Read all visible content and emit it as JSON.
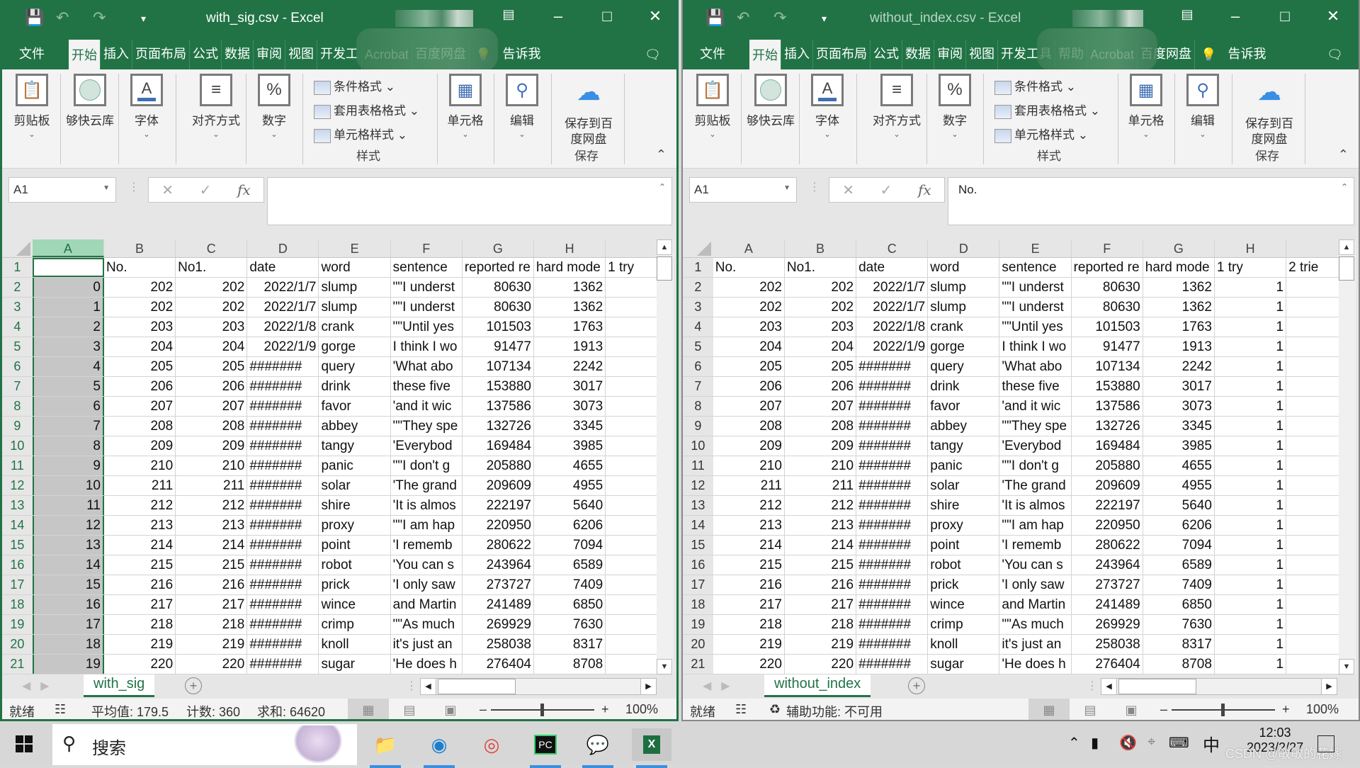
{
  "colors": {
    "excel_green": "#217346",
    "selected_header": "#a0d8b7",
    "selected_col": "#c6c6c6"
  },
  "windows": [
    {
      "title": "with_sig.csv  -  Excel",
      "ribbon_tabs": [
        "文件",
        "开始",
        "插入",
        "页面布局",
        "公式",
        "数据",
        "审阅",
        "视图",
        "开发工",
        "Acrobat",
        "百度网盘"
      ],
      "tell_me": "告诉我",
      "ribbon": {
        "clipboard": "剪贴板",
        "cloud": "够快云库",
        "font": "字体",
        "align": "对齐方式",
        "number": "数字",
        "cond_format": "条件格式",
        "table_format": "套用表格格式",
        "cell_style": "单元格样式",
        "styles_group": "样式",
        "cells": "单元格",
        "edit": "编辑",
        "save_baidu": "保存到百度网盘",
        "save_group": "保存"
      },
      "name_box": "A1",
      "formula": "",
      "columns": [
        "A",
        "B",
        "C",
        "D",
        "E",
        "F",
        "G",
        "H"
      ],
      "selected_column": "A",
      "rows": [
        [
          "",
          "No.",
          "No1.",
          "date",
          "word",
          "sentence",
          "reported re",
          "hard mode",
          "1 try"
        ],
        [
          "0",
          "202",
          "202",
          "2022/1/7",
          "slump",
          "\"\"I underst",
          "80630",
          "1362",
          ""
        ],
        [
          "1",
          "202",
          "202",
          "2022/1/7",
          "slump",
          "\"\"I underst",
          "80630",
          "1362",
          ""
        ],
        [
          "2",
          "203",
          "203",
          "2022/1/8",
          "crank",
          "\"\"Until yes",
          "101503",
          "1763",
          ""
        ],
        [
          "3",
          "204",
          "204",
          "2022/1/9",
          "gorge",
          "I think I wo",
          "91477",
          "1913",
          ""
        ],
        [
          "4",
          "205",
          "205",
          "#######",
          "query",
          "'What abo",
          "107134",
          "2242",
          ""
        ],
        [
          "5",
          "206",
          "206",
          "#######",
          "drink",
          "these five",
          "153880",
          "3017",
          ""
        ],
        [
          "6",
          "207",
          "207",
          "#######",
          "favor",
          "'and it wic",
          "137586",
          "3073",
          ""
        ],
        [
          "7",
          "208",
          "208",
          "#######",
          "abbey",
          "\"\"They spe",
          "132726",
          "3345",
          ""
        ],
        [
          "8",
          "209",
          "209",
          "#######",
          "tangy",
          "'Everybod",
          "169484",
          "3985",
          ""
        ],
        [
          "9",
          "210",
          "210",
          "#######",
          "panic",
          "\"\"I don't g",
          "205880",
          "4655",
          ""
        ],
        [
          "10",
          "211",
          "211",
          "#######",
          "solar",
          "'The grand",
          "209609",
          "4955",
          ""
        ],
        [
          "11",
          "212",
          "212",
          "#######",
          "shire",
          "'It is almos",
          "222197",
          "5640",
          ""
        ],
        [
          "12",
          "213",
          "213",
          "#######",
          "proxy",
          "\"\"I am hap",
          "220950",
          "6206",
          ""
        ],
        [
          "13",
          "214",
          "214",
          "#######",
          "point",
          "'I rememb",
          "280622",
          "7094",
          ""
        ],
        [
          "14",
          "215",
          "215",
          "#######",
          "robot",
          "'You can s",
          "243964",
          "6589",
          ""
        ],
        [
          "15",
          "216",
          "216",
          "#######",
          "prick",
          "'I only saw",
          "273727",
          "7409",
          ""
        ],
        [
          "16",
          "217",
          "217",
          "#######",
          "wince",
          "and Martin",
          "241489",
          "6850",
          ""
        ],
        [
          "17",
          "218",
          "218",
          "#######",
          "crimp",
          "\"\"As much",
          "269929",
          "7630",
          ""
        ],
        [
          "18",
          "219",
          "219",
          "#######",
          "knoll",
          "it's just an",
          "258038",
          "8317",
          ""
        ],
        [
          "19",
          "220",
          "220",
          "#######",
          "sugar",
          "'He does h",
          "276404",
          "8708",
          ""
        ]
      ],
      "sheet_tab": "with_sig",
      "status": {
        "ready": "就绪",
        "average": "平均值: 179.5",
        "count": "计数: 360",
        "sum": "求和: 64620",
        "zoom": "100%"
      }
    },
    {
      "title": "without_index.csv  -  Excel",
      "ribbon_tabs": [
        "文件",
        "开始",
        "插入",
        "页面布局",
        "公式",
        "数据",
        "审阅",
        "视图",
        "开发工具",
        "帮助",
        "Acrobat",
        "百度网盘"
      ],
      "tell_me": "告诉我",
      "ribbon": {
        "clipboard": "剪贴板",
        "cloud": "够快云库",
        "font": "字体",
        "align": "对齐方式",
        "number": "数字",
        "cond_format": "条件格式",
        "table_format": "套用表格格式",
        "cell_style": "单元格样式",
        "styles_group": "样式",
        "cells": "单元格",
        "edit": "编辑",
        "save_baidu": "保存到百度网盘",
        "save_group": "保存"
      },
      "name_box": "A1",
      "formula": "No.",
      "columns": [
        "A",
        "B",
        "C",
        "D",
        "E",
        "F",
        "G",
        "H"
      ],
      "selected_column": "",
      "rows": [
        [
          "No.",
          "No1.",
          "date",
          "word",
          "sentence",
          "reported re",
          "hard mode",
          "1 try",
          "2 trie"
        ],
        [
          "202",
          "202",
          "2022/1/7",
          "slump",
          "\"\"I underst",
          "80630",
          "1362",
          "1",
          ""
        ],
        [
          "202",
          "202",
          "2022/1/7",
          "slump",
          "\"\"I underst",
          "80630",
          "1362",
          "1",
          ""
        ],
        [
          "203",
          "203",
          "2022/1/8",
          "crank",
          "\"\"Until yes",
          "101503",
          "1763",
          "1",
          ""
        ],
        [
          "204",
          "204",
          "2022/1/9",
          "gorge",
          "I think I wo",
          "91477",
          "1913",
          "1",
          ""
        ],
        [
          "205",
          "205",
          "#######",
          "query",
          "'What abo",
          "107134",
          "2242",
          "1",
          ""
        ],
        [
          "206",
          "206",
          "#######",
          "drink",
          "these five",
          "153880",
          "3017",
          "1",
          ""
        ],
        [
          "207",
          "207",
          "#######",
          "favor",
          "'and it wic",
          "137586",
          "3073",
          "1",
          ""
        ],
        [
          "208",
          "208",
          "#######",
          "abbey",
          "\"\"They spe",
          "132726",
          "3345",
          "1",
          ""
        ],
        [
          "209",
          "209",
          "#######",
          "tangy",
          "'Everybod",
          "169484",
          "3985",
          "1",
          ""
        ],
        [
          "210",
          "210",
          "#######",
          "panic",
          "\"\"I don't g",
          "205880",
          "4655",
          "1",
          ""
        ],
        [
          "211",
          "211",
          "#######",
          "solar",
          "'The grand",
          "209609",
          "4955",
          "1",
          ""
        ],
        [
          "212",
          "212",
          "#######",
          "shire",
          "'It is almos",
          "222197",
          "5640",
          "1",
          ""
        ],
        [
          "213",
          "213",
          "#######",
          "proxy",
          "\"\"I am hap",
          "220950",
          "6206",
          "1",
          ""
        ],
        [
          "214",
          "214",
          "#######",
          "point",
          "'I rememb",
          "280622",
          "7094",
          "1",
          ""
        ],
        [
          "215",
          "215",
          "#######",
          "robot",
          "'You can s",
          "243964",
          "6589",
          "1",
          ""
        ],
        [
          "216",
          "216",
          "#######",
          "prick",
          "'I only saw",
          "273727",
          "7409",
          "1",
          ""
        ],
        [
          "217",
          "217",
          "#######",
          "wince",
          "and Martin",
          "241489",
          "6850",
          "1",
          ""
        ],
        [
          "218",
          "218",
          "#######",
          "crimp",
          "\"\"As much",
          "269929",
          "7630",
          "1",
          ""
        ],
        [
          "219",
          "219",
          "#######",
          "knoll",
          "it's just an",
          "258038",
          "8317",
          "1",
          ""
        ],
        [
          "220",
          "220",
          "#######",
          "sugar",
          "'He does h",
          "276404",
          "8708",
          "1",
          ""
        ]
      ],
      "sheet_tab": "without_index",
      "status": {
        "ready": "就绪",
        "accessibility": "辅助功能: 不可用",
        "zoom": "100%"
      }
    }
  ],
  "taskbar": {
    "search_placeholder": "搜索",
    "apps": [
      "file-explorer",
      "edge",
      "chrome",
      "pycharm",
      "wechat",
      "excel"
    ],
    "ime": "中",
    "time": "12:03",
    "date": "2023/2/27",
    "watermark": "CSDN @敏敏的花嫁"
  }
}
